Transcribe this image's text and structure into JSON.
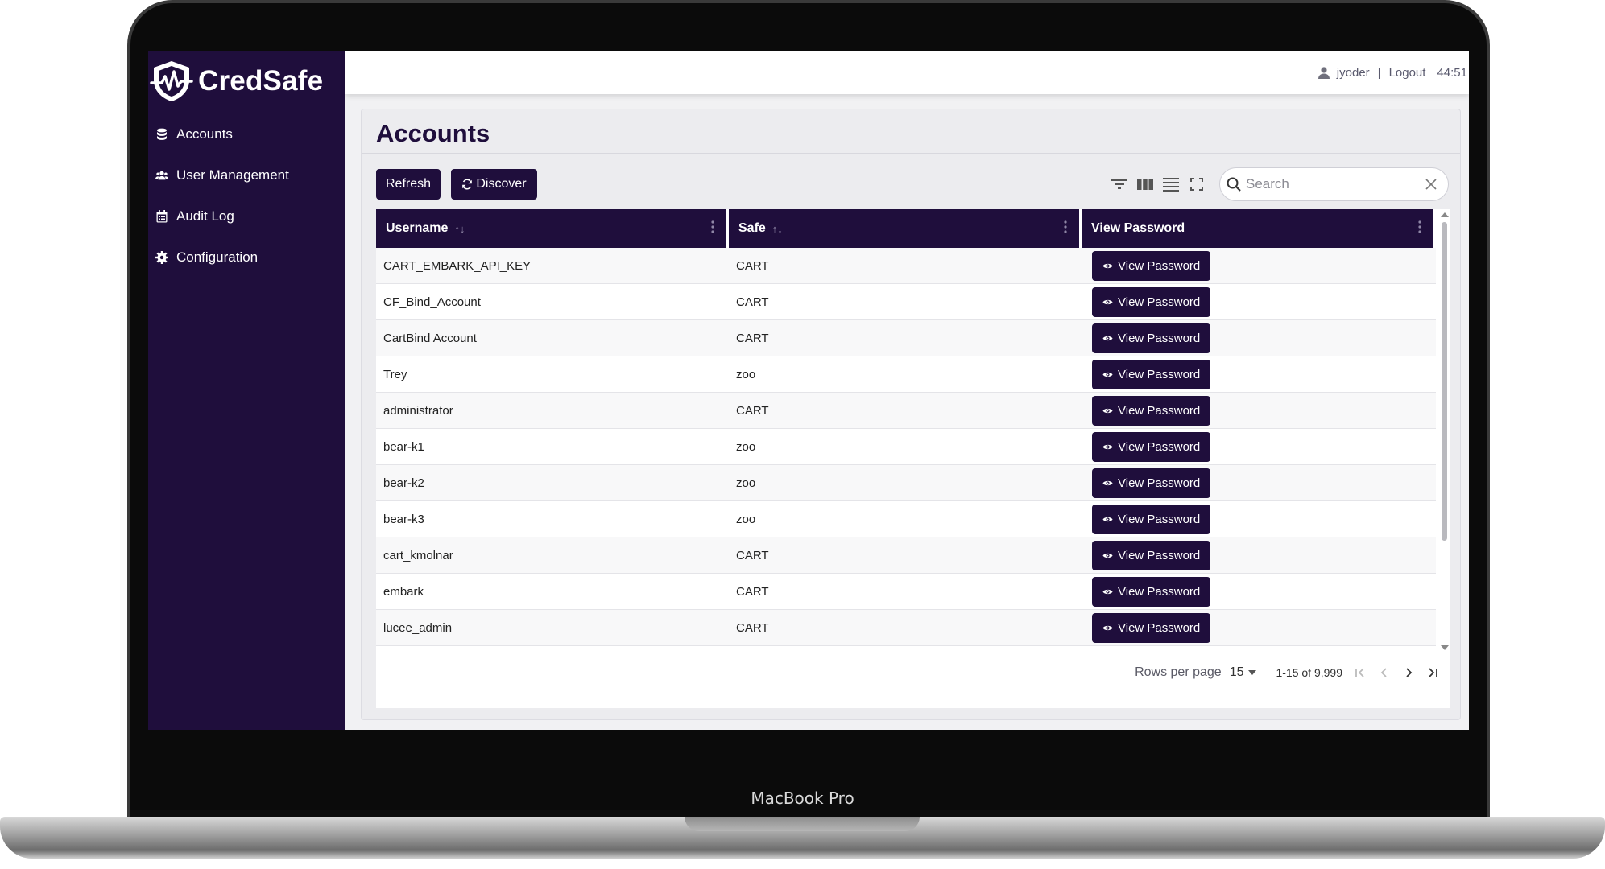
{
  "device": {
    "label": "MacBook Pro"
  },
  "brand": {
    "name": "CredSafe"
  },
  "sidebar": {
    "items": [
      {
        "label": "Accounts",
        "icon": "database-icon"
      },
      {
        "label": "User Management",
        "icon": "users-icon"
      },
      {
        "label": "Audit Log",
        "icon": "calendar-icon"
      },
      {
        "label": "Configuration",
        "icon": "gear-icon"
      }
    ]
  },
  "header": {
    "username": "jyoder",
    "separator": "|",
    "logout_label": "Logout",
    "timer": "44:51"
  },
  "page": {
    "title": "Accounts"
  },
  "toolbar": {
    "refresh_label": "Refresh",
    "discover_label": "Discover",
    "search_placeholder": "Search"
  },
  "table": {
    "columns": [
      {
        "label": "Username"
      },
      {
        "label": "Safe"
      },
      {
        "label": "View Password"
      }
    ],
    "view_button_label": "View Password",
    "rows": [
      {
        "username": "CART_EMBARK_API_KEY",
        "safe": "CART"
      },
      {
        "username": "CF_Bind_Account",
        "safe": "CART"
      },
      {
        "username": "CartBind Account",
        "safe": "CART"
      },
      {
        "username": "Trey",
        "safe": "zoo"
      },
      {
        "username": "administrator",
        "safe": "CART"
      },
      {
        "username": "bear-k1",
        "safe": "zoo"
      },
      {
        "username": "bear-k2",
        "safe": "zoo"
      },
      {
        "username": "bear-k3",
        "safe": "zoo"
      },
      {
        "username": "cart_kmolnar",
        "safe": "CART"
      },
      {
        "username": "embark",
        "safe": "CART"
      },
      {
        "username": "lucee_admin",
        "safe": "CART"
      }
    ]
  },
  "pagination": {
    "rows_per_page_label": "Rows per page",
    "rows_per_page": "15",
    "range": "1-15 of 9,999"
  },
  "colors": {
    "brand": "#1f0e3c",
    "background": "#f1f1f3"
  }
}
